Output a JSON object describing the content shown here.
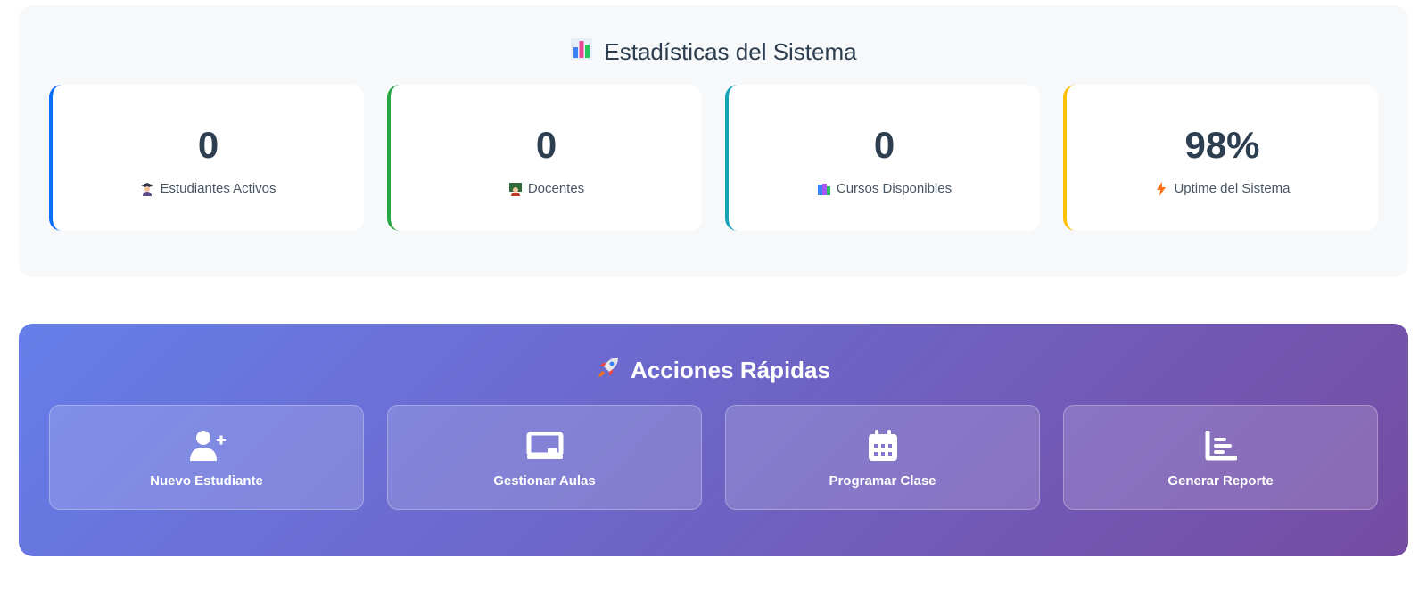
{
  "stats": {
    "title": "Estadísticas del Sistema",
    "title_icon": "bar-chart-icon",
    "cards": [
      {
        "value": "0",
        "label": "Estudiantes Activos",
        "icon": "graduate-icon",
        "accent": "#0d6efd"
      },
      {
        "value": "0",
        "label": "Docentes",
        "icon": "teacher-icon",
        "accent": "#28a745"
      },
      {
        "value": "0",
        "label": "Cursos Disponibles",
        "icon": "books-icon",
        "accent": "#17a2b8"
      },
      {
        "value": "98%",
        "label": "Uptime del Sistema",
        "icon": "lightning-icon",
        "accent": "#ffc107"
      }
    ]
  },
  "actions": {
    "title": "Acciones Rápidas",
    "title_icon": "rocket-icon",
    "gradient": [
      "#667eea",
      "#764ba2"
    ],
    "items": [
      {
        "label": "Nuevo Estudiante",
        "icon": "user-plus-icon"
      },
      {
        "label": "Gestionar Aulas",
        "icon": "chalkboard-icon"
      },
      {
        "label": "Programar Clase",
        "icon": "calendar-icon"
      },
      {
        "label": "Generar Reporte",
        "icon": "chart-report-icon"
      }
    ]
  }
}
